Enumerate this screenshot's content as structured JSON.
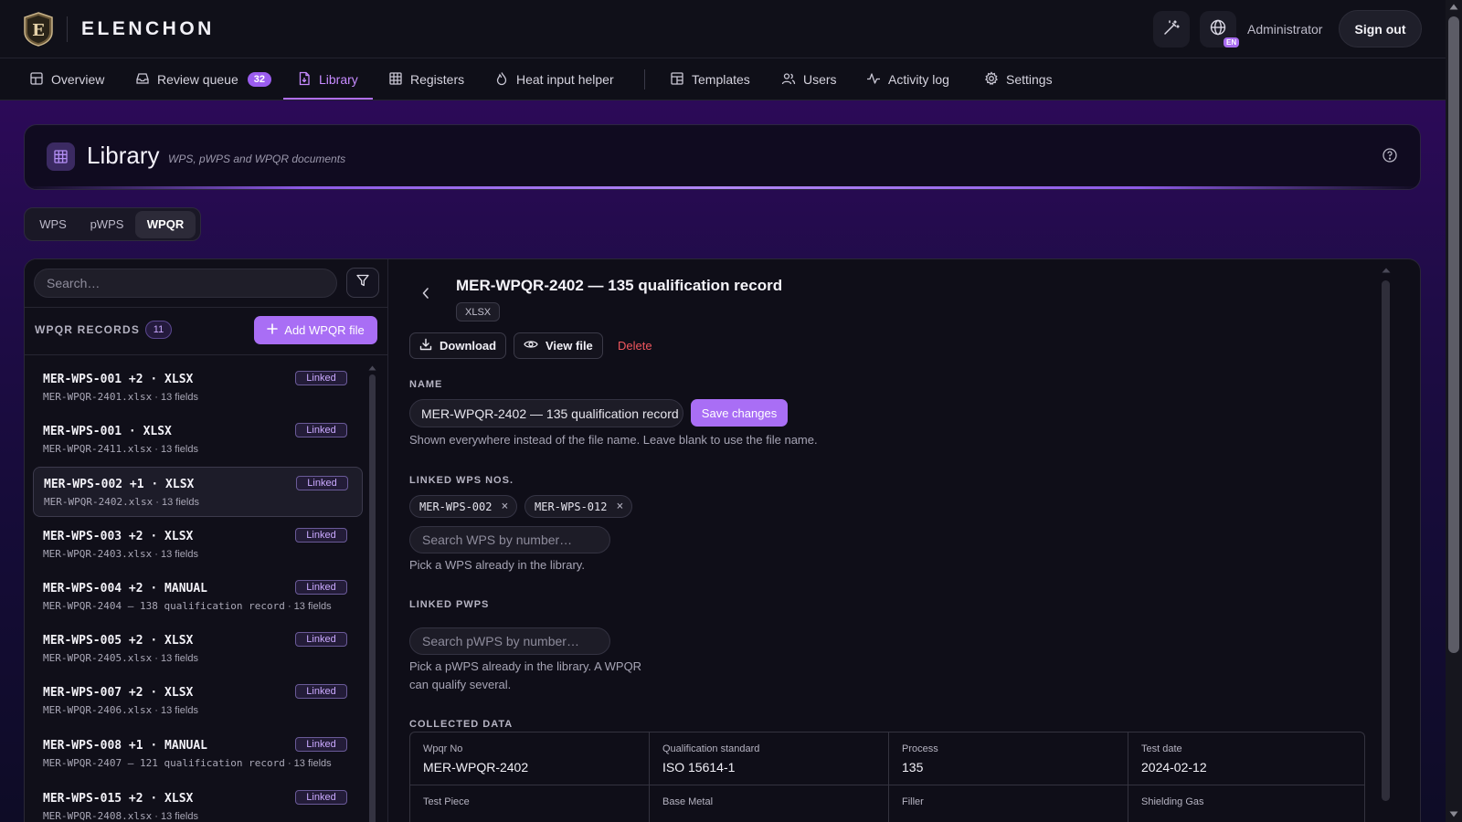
{
  "app": {
    "brand": "ELENCHON",
    "user": "Administrator",
    "signout_label": "Sign out",
    "lang_badge": "EN"
  },
  "nav": {
    "items": [
      {
        "label": "Overview",
        "icon": "layout-icon"
      },
      {
        "label": "Review queue",
        "icon": "inbox-icon",
        "count": "32"
      },
      {
        "label": "Library",
        "icon": "file-icon",
        "active": true
      },
      {
        "label": "Registers",
        "icon": "table-icon"
      },
      {
        "label": "Heat input helper",
        "icon": "flame-icon"
      },
      {
        "label": "Templates",
        "icon": "template-icon"
      },
      {
        "label": "Users",
        "icon": "users-icon"
      },
      {
        "label": "Activity log",
        "icon": "activity-icon"
      },
      {
        "label": "Settings",
        "icon": "gear-icon"
      }
    ]
  },
  "header": {
    "title": "Library",
    "subtitle": "WPS, pWPS and WPQR documents"
  },
  "doc_tabs": [
    {
      "label": "WPS"
    },
    {
      "label": "pWPS"
    },
    {
      "label": "WPQR",
      "active": true
    }
  ],
  "sidebar": {
    "search_placeholder": "Search…",
    "records_label": "WPQR RECORDS",
    "records_count": "11",
    "add_label": "Add WPQR file",
    "records": [
      {
        "title": "MER-WPS-001 +2 · XLSX",
        "file": "MER-WPQR-2401.xlsx",
        "fields": " · 13 fields",
        "badge": "Linked"
      },
      {
        "title": "MER-WPS-001 · XLSX",
        "file": "MER-WPQR-2411.xlsx",
        "fields": " · 13 fields",
        "badge": "Linked"
      },
      {
        "title": "MER-WPS-002 +1 · XLSX",
        "file": "MER-WPQR-2402.xlsx",
        "fields": " · 13 fields",
        "badge": "Linked",
        "selected": true
      },
      {
        "title": "MER-WPS-003 +2 · XLSX",
        "file": "MER-WPQR-2403.xlsx",
        "fields": " · 13 fields",
        "badge": "Linked"
      },
      {
        "title": "MER-WPS-004 +2 · MANUAL",
        "file": "MER-WPQR-2404 — 138 qualification record",
        "fields": " · 13 fields",
        "badge": "Linked"
      },
      {
        "title": "MER-WPS-005 +2 · XLSX",
        "file": "MER-WPQR-2405.xlsx",
        "fields": " · 13 fields",
        "badge": "Linked"
      },
      {
        "title": "MER-WPS-007 +2 · XLSX",
        "file": "MER-WPQR-2406.xlsx",
        "fields": " · 13 fields",
        "badge": "Linked"
      },
      {
        "title": "MER-WPS-008 +1 · MANUAL",
        "file": "MER-WPQR-2407 — 121 qualification record",
        "fields": " · 13 fields",
        "badge": "Linked"
      },
      {
        "title": "MER-WPS-015 +2 · XLSX",
        "file": "MER-WPQR-2408.xlsx",
        "fields": " · 13 fields",
        "badge": "Linked"
      }
    ]
  },
  "detail": {
    "title": "MER-WPQR-2402 — 135 qualification record",
    "format": "XLSX",
    "download_label": "Download",
    "view_label": "View file",
    "delete_label": "Delete",
    "name_label": "NAME",
    "name_value": "MER-WPQR-2402 — 135 qualification record",
    "save_label": "Save changes",
    "name_hint": "Shown everywhere instead of the file name. Leave blank to use the file name.",
    "linked_wps_label": "LINKED WPS NOS.",
    "linked_wps": [
      "MER-WPS-002",
      "MER-WPS-012"
    ],
    "wps_search_placeholder": "Search WPS by number…",
    "wps_hint": "Pick a WPS already in the library.",
    "linked_pwps_label": "LINKED PWPS",
    "pwps_search_placeholder": "Search pWPS by number…",
    "pwps_hint_1": "Pick a pWPS already in the library. A WPQR",
    "pwps_hint_2": "can qualify several.",
    "collected_label": "COLLECTED DATA",
    "collected": [
      {
        "label": "Wpqr No",
        "value": "MER-WPQR-2402"
      },
      {
        "label": "Qualification standard",
        "value": "ISO 15614-1"
      },
      {
        "label": "Process",
        "value": "135"
      },
      {
        "label": "Test date",
        "value": "2024-02-12"
      },
      {
        "label": "Test Piece",
        "value": ""
      },
      {
        "label": "Base Metal",
        "value": ""
      },
      {
        "label": "Filler",
        "value": ""
      },
      {
        "label": "Shielding Gas",
        "value": ""
      }
    ]
  },
  "colors": {
    "accent": "#a96ef5",
    "danger": "#f0575e",
    "badge_text": "#caa9ff"
  }
}
